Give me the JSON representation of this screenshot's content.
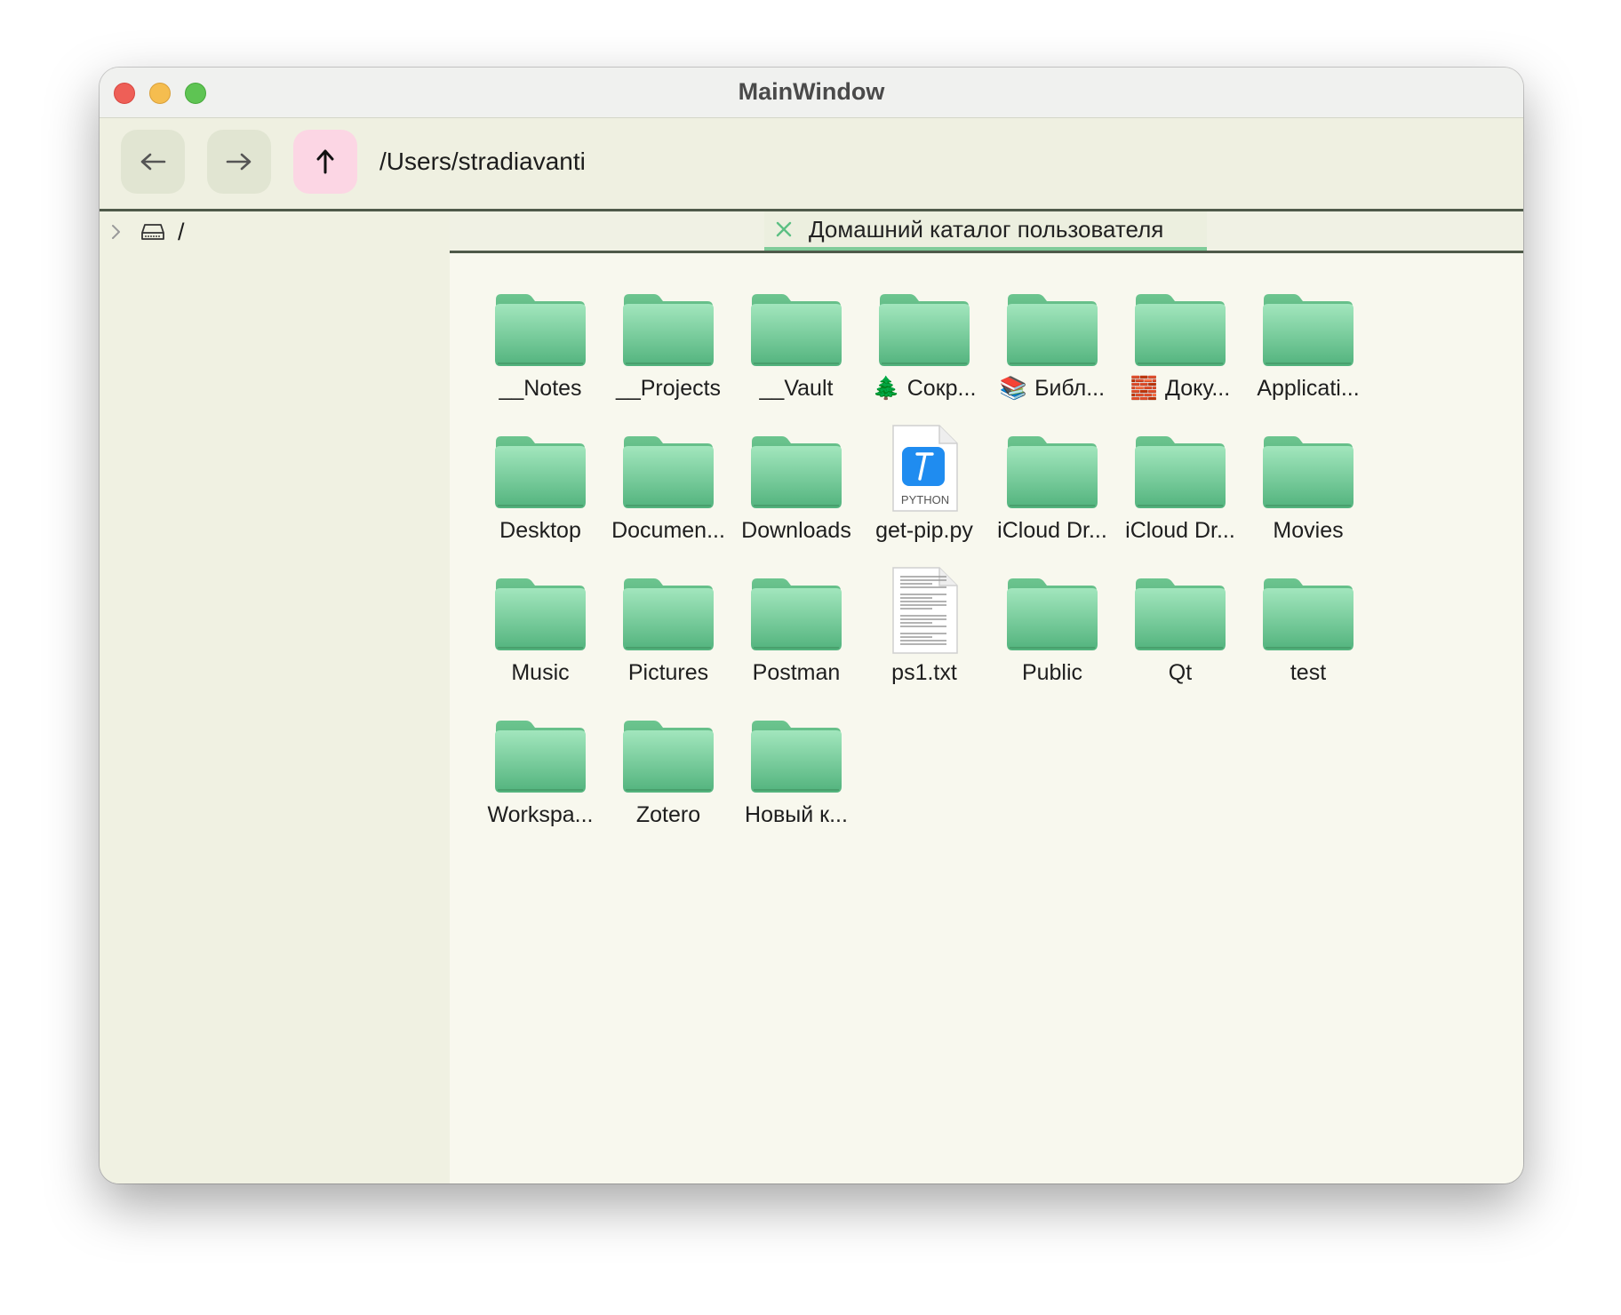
{
  "window": {
    "title": "MainWindow"
  },
  "toolbar": {
    "back_label": "back",
    "forward_label": "forward",
    "up_label": "up",
    "path": "/Users/stradiavanti"
  },
  "sidebar": {
    "root_label": "/"
  },
  "tab": {
    "label": "Домашний каталог пользователя"
  },
  "colors": {
    "folder_top": "#a2e6bd",
    "folder_bottom": "#52b37d",
    "tab_accent": "#7fcb99",
    "up_button_bg": "#fcd6e4"
  },
  "items": [
    {
      "label": "__Notes",
      "type": "folder",
      "emoji": ""
    },
    {
      "label": "__Projects",
      "type": "folder",
      "emoji": ""
    },
    {
      "label": "__Vault",
      "type": "folder",
      "emoji": ""
    },
    {
      "label": "Сокр...",
      "type": "folder",
      "emoji": "🌲"
    },
    {
      "label": "Библ...",
      "type": "folder",
      "emoji": "📚"
    },
    {
      "label": "Доку...",
      "type": "folder",
      "emoji": "🧱"
    },
    {
      "label": "Applicati...",
      "type": "folder",
      "emoji": ""
    },
    {
      "label": "Desktop",
      "type": "folder",
      "emoji": ""
    },
    {
      "label": "Documen...",
      "type": "folder",
      "emoji": ""
    },
    {
      "label": "Downloads",
      "type": "folder",
      "emoji": ""
    },
    {
      "label": "get-pip.py",
      "type": "python",
      "emoji": "",
      "badge": "PYTHON"
    },
    {
      "label": "iCloud Dr...",
      "type": "folder",
      "emoji": ""
    },
    {
      "label": "iCloud Dr...",
      "type": "folder",
      "emoji": ""
    },
    {
      "label": "Movies",
      "type": "folder",
      "emoji": ""
    },
    {
      "label": "Music",
      "type": "folder",
      "emoji": ""
    },
    {
      "label": "Pictures",
      "type": "folder",
      "emoji": ""
    },
    {
      "label": "Postman",
      "type": "folder",
      "emoji": ""
    },
    {
      "label": "ps1.txt",
      "type": "text",
      "emoji": ""
    },
    {
      "label": "Public",
      "type": "folder",
      "emoji": ""
    },
    {
      "label": "Qt",
      "type": "folder",
      "emoji": ""
    },
    {
      "label": "test",
      "type": "folder",
      "emoji": ""
    },
    {
      "label": "Workspa...",
      "type": "folder",
      "emoji": ""
    },
    {
      "label": "Zotero",
      "type": "folder",
      "emoji": ""
    },
    {
      "label": "Новый к...",
      "type": "folder",
      "emoji": ""
    }
  ]
}
